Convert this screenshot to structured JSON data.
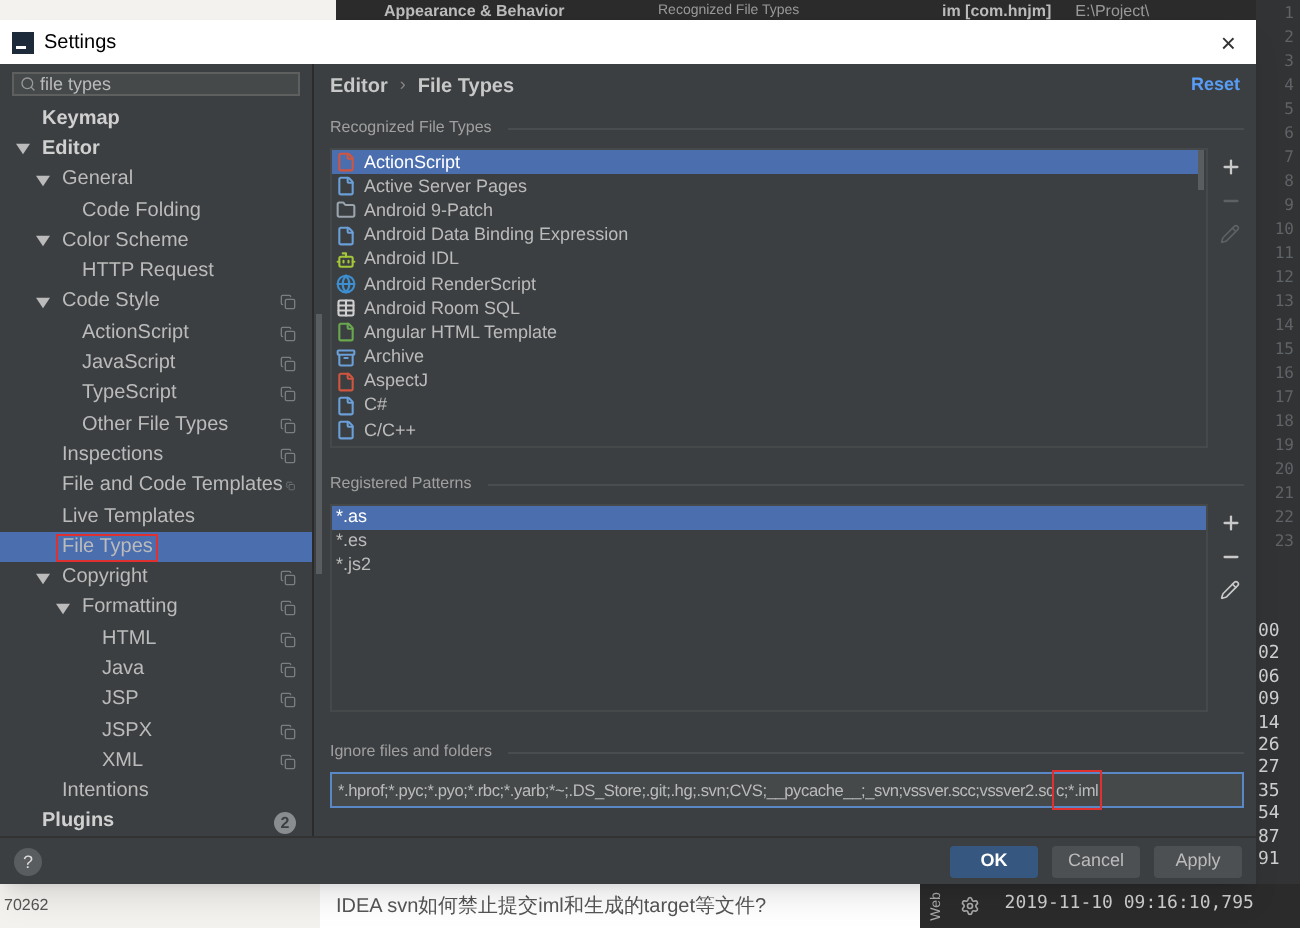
{
  "background": {
    "top_left_title": "Appearance & Behavior",
    "top_label": "Recognized File Types",
    "project": "im [com.hnjm]",
    "project_path": "E:\\Project\\",
    "line_numbers": [
      "1",
      "2",
      "3",
      "4",
      "5",
      "6",
      "7",
      "8",
      "9",
      "10",
      "11",
      "12",
      "13",
      "14",
      "15",
      "16",
      "17",
      "18",
      "19",
      "20",
      "21",
      "22",
      "23"
    ],
    "log_numbers": [
      "00",
      "02",
      "06",
      "09",
      "14",
      "26",
      "27",
      "35",
      "54",
      "87",
      "91"
    ],
    "side_number": "70262",
    "article_title": "IDEA svn如何禁止提交iml和生成的target等文件?",
    "tool_tab": "Web",
    "timestamp": "2019-11-10 09:16:10,795"
  },
  "window": {
    "title": "Settings",
    "close": "×"
  },
  "search": {
    "value": "file types"
  },
  "sidebar": {
    "items": [
      {
        "label": "Keymap",
        "bold": true,
        "selected": false,
        "project_level": false,
        "highlighted": false
      },
      {
        "label": "Editor",
        "bold": true,
        "selected": false,
        "project_level": false,
        "highlighted": false,
        "expanded": true,
        "children": [
          {
            "label": "General",
            "selected": false,
            "project_level": false,
            "highlighted": false,
            "expanded": true,
            "children": [
              {
                "label": "Code Folding",
                "selected": false,
                "project_level": false,
                "highlighted": false
              }
            ]
          },
          {
            "label": "Color Scheme",
            "selected": false,
            "project_level": false,
            "highlighted": false,
            "expanded": true,
            "children": [
              {
                "label": "HTTP Request",
                "selected": false,
                "project_level": false,
                "highlighted": false
              }
            ]
          },
          {
            "label": "Code Style",
            "selected": false,
            "project_level": true,
            "highlighted": false,
            "expanded": true,
            "children": [
              {
                "label": "ActionScript",
                "selected": false,
                "project_level": true,
                "highlighted": false
              },
              {
                "label": "JavaScript",
                "selected": false,
                "project_level": true,
                "highlighted": false
              },
              {
                "label": "TypeScript",
                "selected": false,
                "project_level": true,
                "highlighted": false
              },
              {
                "label": "Other File Types",
                "selected": false,
                "project_level": true,
                "highlighted": false
              }
            ]
          },
          {
            "label": "Inspections",
            "selected": false,
            "project_level": true,
            "highlighted": false
          },
          {
            "label": "File and Code Templates",
            "selected": false,
            "project_level": true,
            "highlighted": false
          },
          {
            "label": "Live Templates",
            "selected": false,
            "project_level": false,
            "highlighted": false
          },
          {
            "label": "File Types",
            "selected": true,
            "project_level": false,
            "highlighted": true
          },
          {
            "label": "Copyright",
            "selected": false,
            "project_level": true,
            "highlighted": false,
            "expanded": true,
            "children": [
              {
                "label": "Formatting",
                "selected": false,
                "project_level": true,
                "highlighted": false,
                "expanded": true,
                "children": [
                  {
                    "label": "HTML",
                    "selected": false,
                    "project_level": true,
                    "highlighted": false
                  },
                  {
                    "label": "Java",
                    "selected": false,
                    "project_level": true,
                    "highlighted": false
                  },
                  {
                    "label": "JSP",
                    "selected": false,
                    "project_level": true,
                    "highlighted": false
                  },
                  {
                    "label": "JSPX",
                    "selected": false,
                    "project_level": true,
                    "highlighted": false
                  },
                  {
                    "label": "XML",
                    "selected": false,
                    "project_level": true,
                    "highlighted": false
                  }
                ]
              }
            ]
          },
          {
            "label": "Intentions",
            "selected": false,
            "project_level": false,
            "highlighted": false
          }
        ]
      },
      {
        "label": "Plugins",
        "bold": true,
        "selected": false,
        "project_level": false,
        "highlighted": false,
        "badge": "2"
      }
    ]
  },
  "breadcrumb": [
    "Editor",
    "File Types"
  ],
  "breadcrumb_separator": "›",
  "reset": "Reset",
  "recognized": {
    "title": "Recognized File Types",
    "items": [
      {
        "label": "ActionScript",
        "kind": "file",
        "color": "#d2553f",
        "selected": true
      },
      {
        "label": "Active Server Pages",
        "kind": "file",
        "color": "#6a9fd8",
        "selected": false
      },
      {
        "label": "Android 9-Patch",
        "kind": "folder",
        "color": "#9aa4ad",
        "selected": false
      },
      {
        "label": "Android Data Binding Expression",
        "kind": "file",
        "color": "#6a9fd8",
        "selected": false
      },
      {
        "label": "Android IDL",
        "kind": "android",
        "color": "#a4c639",
        "selected": false
      },
      {
        "label": "Android RenderScript",
        "kind": "globe",
        "color": "#3d8fd1",
        "selected": false
      },
      {
        "label": "Android Room SQL",
        "kind": "table",
        "color": "#d0d0d0",
        "selected": false
      },
      {
        "label": "Angular HTML Template",
        "kind": "file",
        "color": "#6aa84f",
        "selected": false
      },
      {
        "label": "Archive",
        "kind": "archive",
        "color": "#6a9fd8",
        "selected": false
      },
      {
        "label": "AspectJ",
        "kind": "file",
        "color": "#d2553f",
        "selected": false
      },
      {
        "label": "C#",
        "kind": "file",
        "color": "#6a9fd8",
        "selected": false
      },
      {
        "label": "C/C++",
        "kind": "file",
        "color": "#6a9fd8",
        "selected": false
      }
    ]
  },
  "patterns": {
    "title": "Registered Patterns",
    "items": [
      {
        "label": "*.as",
        "selected": true
      },
      {
        "label": "*.es",
        "selected": false
      },
      {
        "label": "*.js2",
        "selected": false
      }
    ]
  },
  "ignore": {
    "label": "Ignore files and folders",
    "value": "*.hprof;*.pyc;*.pyo;*.rbc;*.yarb;*~;.DS_Store;.git;.hg;.svn;CVS;__pycache__;_svn;vssver.scc;vssver2.sc",
    "marked_part": "c;*.iml"
  },
  "help": "?",
  "buttons": [
    {
      "label": "OK",
      "kind": "primary"
    },
    {
      "label": "Cancel",
      "kind": "normal"
    },
    {
      "label": "Apply",
      "kind": "normal"
    }
  ]
}
